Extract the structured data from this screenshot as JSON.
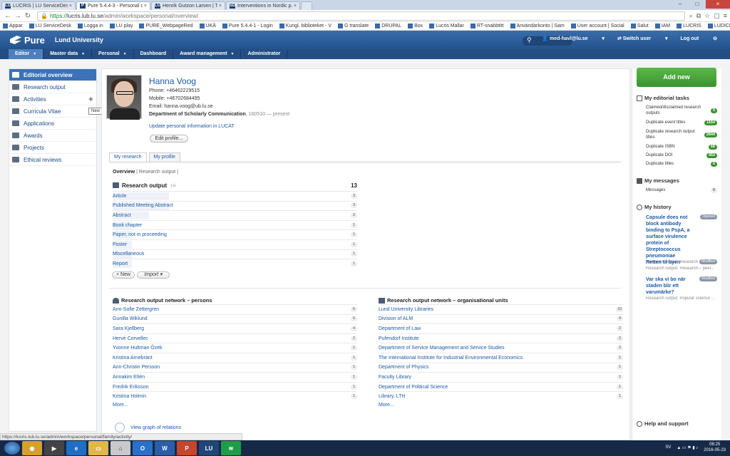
{
  "browser": {
    "tabs": [
      {
        "icon": "LU",
        "title": "LUCRIS | LU ServiceDesk"
      },
      {
        "icon": "P",
        "title": "Pure 5.4.4-3 - Personal o..."
      },
      {
        "icon": "LU",
        "title": "Henrik Gutzon Larsen | Th"
      },
      {
        "icon": "SD",
        "title": "Interventions in Nordic p..."
      }
    ],
    "url_prefix": "https://",
    "url_host": "lucris.lub.lu.se",
    "url_path": "/admin/workspace/personal/overview/",
    "bookmarks": [
      "Appar",
      "LU ServiceDesk",
      "Logga in",
      "LU play",
      "PURE_WebpageRed",
      "UKÄ",
      "Pure 5.4.4-1 - Login",
      "Kungl. biblioteket - V",
      "G translate",
      "DRUPAL",
      "Box",
      "Lucris Mallar",
      "RT-snabbtitt",
      "Användarkonto | Sam",
      "User account | Social",
      "Salut",
      "IAM",
      "LUCRIS",
      "LUDICRIS NY"
    ]
  },
  "header": {
    "logo": "Pure",
    "university": "Lund University",
    "user": "med-havl@lu.se",
    "switch_user": "Switch user",
    "logout": "Log out"
  },
  "menu": [
    "Editor",
    "Master data",
    "Personal",
    "Dashboard",
    "Award management",
    "Administrator"
  ],
  "sidebar": {
    "items": [
      "Editorial overview",
      "Research output",
      "Activities",
      "Curricula Vitae",
      "Applications",
      "Awards",
      "Projects",
      "Ethical reviews"
    ],
    "tooltip": "New"
  },
  "profile": {
    "name": "Hanna Voog",
    "phone": "Phone: +46462229515",
    "mobile": "Mobile: +46702684495",
    "email_label": "Email:",
    "email": "hanna.voog@ub.lu.se",
    "department": "Department of Scholarly Communication",
    "dept_detail": ", 160510 — present",
    "update_link": "Update personal information in LUCAT",
    "edit_button": "Edit profile..."
  },
  "tabs": [
    "My research",
    "My profile"
  ],
  "subtabs": [
    "Overview",
    "Research output"
  ],
  "research_output": {
    "title": "Research output",
    "total": "13",
    "new_button": "New",
    "import_button": "Import",
    "rows": [
      {
        "label": "Article",
        "count": "3",
        "share": 0.23
      },
      {
        "label": "Published Meeting Abstract",
        "count": "3",
        "share": 0.23
      },
      {
        "label": "Abstract",
        "count": "2",
        "share": 0.15
      },
      {
        "label": "Book chapter",
        "count": "1",
        "share": 0.08
      },
      {
        "label": "Paper, not in proceeding",
        "count": "1",
        "share": 0.08
      },
      {
        "label": "Poster",
        "count": "1",
        "share": 0.08
      },
      {
        "label": "Miscellaneous",
        "count": "1",
        "share": 0.08
      },
      {
        "label": "Report",
        "count": "1",
        "share": 0.08
      }
    ]
  },
  "network_persons": {
    "title": "Research output network – persons",
    "rows": [
      {
        "name": "Ann-Sofie Zettergren",
        "count": "6"
      },
      {
        "name": "Gunilla Wiklund",
        "count": "6"
      },
      {
        "name": "Sara Kjellberg",
        "count": "4"
      },
      {
        "name": "Hervé Corvellec",
        "count": "2"
      },
      {
        "name": "Yvonne Hultman Özek",
        "count": "1"
      },
      {
        "name": "Kristina Arnebrant",
        "count": "1"
      },
      {
        "name": "Ann-Christin Persson",
        "count": "1"
      },
      {
        "name": "Annakim Eltén",
        "count": "1"
      },
      {
        "name": "Fredrik Eriksson",
        "count": "1"
      },
      {
        "name": "Kristina Holmin",
        "count": "1"
      }
    ],
    "more": "More..."
  },
  "network_units": {
    "title": "Research output network – organisational units",
    "rows": [
      {
        "name": "Lund University Libraries",
        "count": "10"
      },
      {
        "name": "Division of ALM",
        "count": "4"
      },
      {
        "name": "Department of Law",
        "count": "2"
      },
      {
        "name": "Pufendorf Institute",
        "count": "2"
      },
      {
        "name": "Department of Service Management and Service Studies",
        "count": "2"
      },
      {
        "name": "The International Institute for Industrial Environmental Economics",
        "count": "1"
      },
      {
        "name": "Department of Physics",
        "count": "1"
      },
      {
        "name": "Faculty Library",
        "count": "1"
      },
      {
        "name": "Department of Political Science",
        "count": "1"
      },
      {
        "name": "Library, LTH",
        "count": "1"
      }
    ],
    "more": "More..."
  },
  "graph_link": "View graph of relations",
  "right_panel": {
    "add_new": "Add new",
    "tasks_title": "My editorial tasks",
    "tasks": [
      {
        "label": "Claimed/disclaimed research outputs",
        "count": "5"
      },
      {
        "label": "Duplicate event titles",
        "count": "1164"
      },
      {
        "label": "Duplicate research output titles",
        "count": "2844"
      },
      {
        "label": "Duplicate ISBN",
        "count": "68"
      },
      {
        "label": "Duplicate DOI",
        "count": "453"
      },
      {
        "label": "Duplicate titles",
        "count": "6"
      }
    ],
    "messages_title": "My messages",
    "messages_label": "Messages",
    "messages_count": "0",
    "history_title": "My history",
    "history": [
      {
        "title": "Capsule does not block antibody binding to PspA, a surface virulence protein of Streptococcus pneumoniae",
        "sub": "Research output: Research – peer...",
        "status": "Opened"
      },
      {
        "title": "Retten til byen",
        "sub": "Research output: Research – peer...",
        "status": "Modified"
      },
      {
        "title": "Var ska vi bo när staden blir ett varumärke?",
        "sub": "Research output: Popular science ...",
        "status": "Modified"
      }
    ],
    "help": "Help and support"
  },
  "statusbar": "https://lucris.lub.lu.se/admin/workspace/personal/family/activity/",
  "taskbar": {
    "lang": "SV",
    "time": "08:25",
    "date": "2016-05-23"
  },
  "colors": {
    "header_blue": "#2e5f9b",
    "link_blue": "#1a5aa8",
    "green": "#3a922e"
  }
}
